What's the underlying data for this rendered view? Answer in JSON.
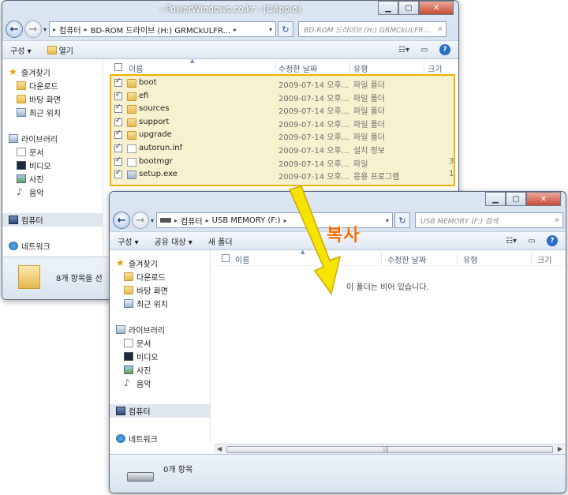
{
  "window1": {
    "title": "- PowerWindows.co.kr - [CApple]",
    "address": {
      "segments": [
        "컴퓨터",
        "BD-ROM 드라이브 (H:) GRMCkULFR..."
      ]
    },
    "search_placeholder": "BD-ROM 드라이브 (H:) GRMCkULFR...",
    "toolbar": {
      "organize": "구성 ▾",
      "open": "열기"
    },
    "nav": {
      "favorites": "즐겨찾기",
      "favorites_items": [
        "다운로드",
        "바탕 화면",
        "최근 위치"
      ],
      "libraries": "라이브러리",
      "libraries_items": [
        "문서",
        "비디오",
        "사진",
        "음악"
      ],
      "computer": "컴퓨터",
      "network": "네트워크"
    },
    "columns": {
      "name": "이름",
      "modified": "수정한 날짜",
      "type": "유형",
      "size": "크기"
    },
    "files": [
      {
        "name": "boot",
        "date": "2009-07-14 오후...",
        "type": "파일 폴더",
        "size": "",
        "icon": "folder"
      },
      {
        "name": "efi",
        "date": "2009-07-14 오후...",
        "type": "파일 폴더",
        "size": "",
        "icon": "folder"
      },
      {
        "name": "sources",
        "date": "2009-07-14 오후...",
        "type": "파일 폴더",
        "size": "",
        "icon": "folder"
      },
      {
        "name": "support",
        "date": "2009-07-14 오후...",
        "type": "파일 폴더",
        "size": "",
        "icon": "folder"
      },
      {
        "name": "upgrade",
        "date": "2009-07-14 오후...",
        "type": "파일 폴더",
        "size": "",
        "icon": "folder"
      },
      {
        "name": "autorun.inf",
        "date": "2009-07-14 오후...",
        "type": "설치 정보",
        "size": "",
        "icon": "file"
      },
      {
        "name": "bootmgr",
        "date": "2009-07-14 오후...",
        "type": "파일",
        "size": "3",
        "icon": "file"
      },
      {
        "name": "setup.exe",
        "date": "2009-07-14 오후...",
        "type": "응용 프로그램",
        "size": "1",
        "icon": "exe"
      }
    ],
    "status": "8개 항목을 선"
  },
  "window2": {
    "address": {
      "segments": [
        "컴퓨터",
        "USB MEMORY (F:)"
      ]
    },
    "search_placeholder": "USB MEMORY (F:) 검색",
    "toolbar": {
      "organize": "구성 ▾",
      "share": "공유 대상 ▾",
      "new_folder": "새 폴더"
    },
    "nav": {
      "favorites": "즐겨찾기",
      "favorites_items": [
        "다운로드",
        "바탕 화면",
        "최근 위치"
      ],
      "libraries": "라이브러리",
      "libraries_items": [
        "문서",
        "비디오",
        "사진",
        "음악"
      ],
      "computer": "컴퓨터",
      "network": "네트워크"
    },
    "columns": {
      "name": "이름",
      "modified": "수정한 날짜",
      "type": "유형",
      "size": "크기"
    },
    "empty_message": "이 폴더는 비어 있습니다.",
    "status": "0개 항목"
  },
  "annotation": {
    "label": "복사",
    "color": "#ff6a00",
    "arrow_color": "#f5e400"
  }
}
